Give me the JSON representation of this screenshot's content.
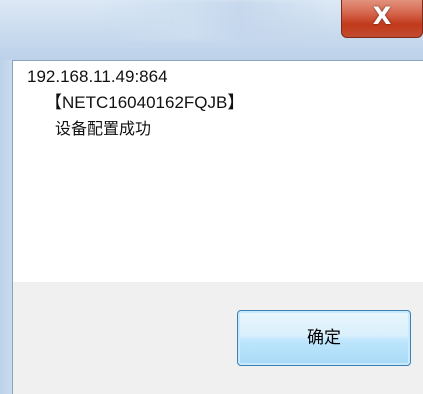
{
  "dialog": {
    "close_glyph": "X",
    "message": {
      "address": "192.168.11.49:864",
      "device_id": "【NETC16040162FQJB】",
      "status": "设备配置成功"
    },
    "ok_label": "确定"
  },
  "colors": {
    "close_button": "#c94a2f",
    "title_bar": "#c9dbee",
    "ok_button_border": "#3c7fb1",
    "footer_bg": "#f0f0f0"
  }
}
